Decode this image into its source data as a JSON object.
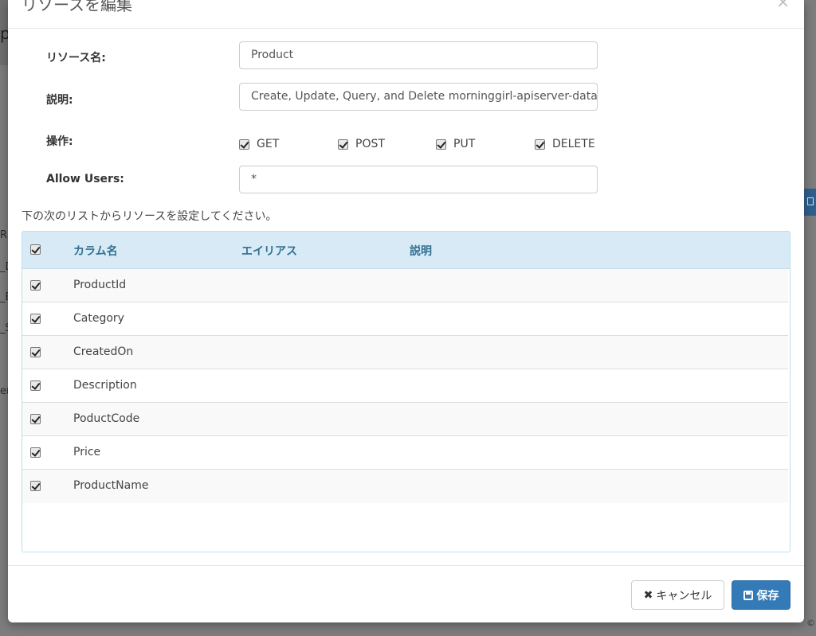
{
  "modal": {
    "title": "リソースを編集",
    "close_glyph": "×"
  },
  "form": {
    "resource_name_label": "リソース名:",
    "resource_name_value": "Product",
    "description_label": "説明:",
    "description_value": "Create, Update, Query, and Delete morninggirl-apiserver-database",
    "operations_label": "操作:",
    "operations": [
      {
        "label": "GET",
        "checked": true
      },
      {
        "label": "POST",
        "checked": true
      },
      {
        "label": "PUT",
        "checked": true
      },
      {
        "label": "DELETE",
        "checked": true
      }
    ],
    "allow_users_label": "Allow Users:",
    "allow_users_value": "*"
  },
  "instruction": "下の次のリストからリソースを設定してください。",
  "table": {
    "headers": [
      "カラム名",
      "エイリアス",
      "説明"
    ],
    "rows": [
      {
        "column": "ProductId",
        "checked": true
      },
      {
        "column": "Category",
        "checked": true
      },
      {
        "column": "CreatedOn",
        "checked": true
      },
      {
        "column": "Description",
        "checked": true
      },
      {
        "column": "PoductCode",
        "checked": true
      },
      {
        "column": "Price",
        "checked": true
      },
      {
        "column": "ProductName",
        "checked": true
      }
    ]
  },
  "footer": {
    "cancel_label": "キャンセル",
    "save_label": "保存"
  },
  "colors": {
    "primary": "#337ab7",
    "table_header_bg": "#d9eaf7",
    "table_header_text": "#31708f"
  }
}
